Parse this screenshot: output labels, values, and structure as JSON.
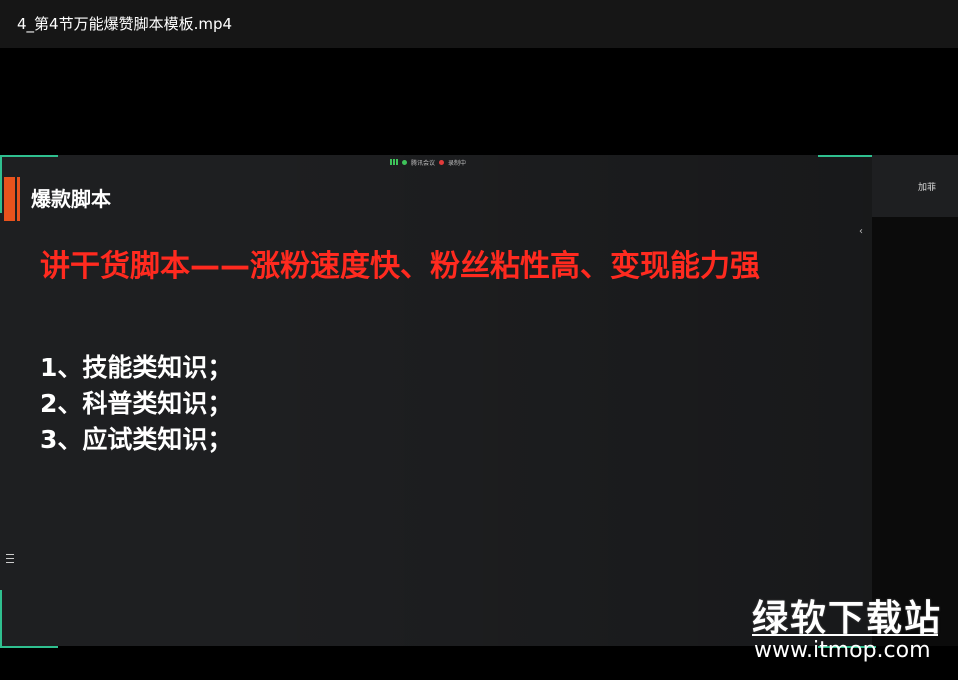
{
  "window": {
    "title": "4_第4节万能爆赞脚本模板.mp4"
  },
  "meeting": {
    "app_label": "腾讯会议",
    "recording_label": "录制中"
  },
  "slide": {
    "heading": "爆款脚本",
    "main_line": "讲干货脚本——涨粉速度快、粉丝粘性高、变现能力强",
    "items": [
      "1、技能类知识；",
      "2、科普类知识；",
      "3、应试类知识；"
    ]
  },
  "side_panel": {
    "label": "加菲",
    "collapse_icon": "chevron-left-icon"
  },
  "watermark": {
    "name": "绿软下载站",
    "url": "www.itmop.com"
  },
  "colors": {
    "accent": "#e8531d",
    "headline_red": "#ff2a1f",
    "frame_corner": "#2fbf8f"
  }
}
